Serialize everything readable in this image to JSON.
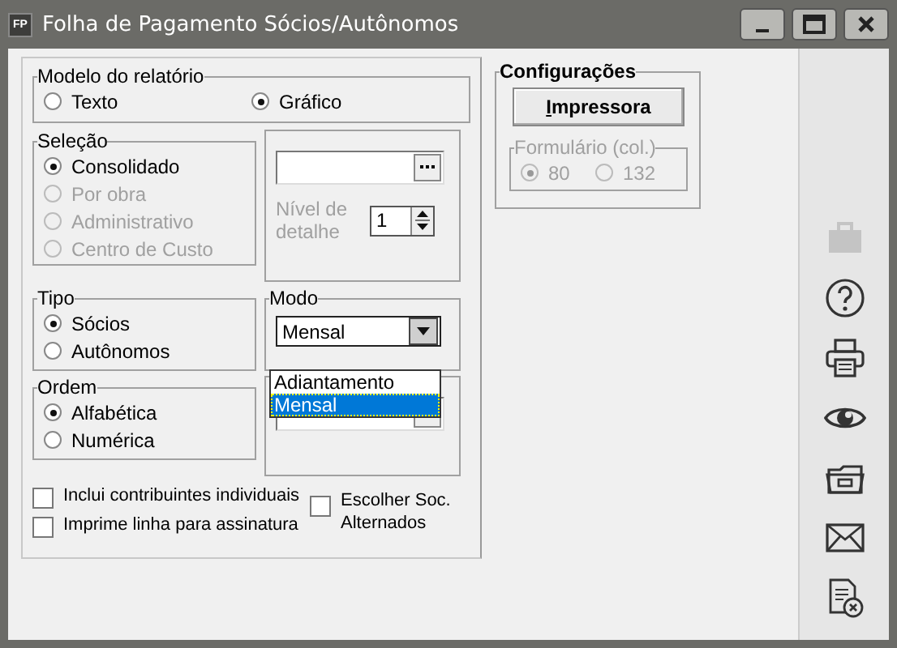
{
  "window": {
    "title": "Folha de Pagamento Sócios/Autônomos",
    "icon": "FP"
  },
  "report_model": {
    "label": "Modelo do relatório",
    "options": [
      {
        "label": "Texto",
        "selected": false,
        "disabled": false
      },
      {
        "label": "Gráfico",
        "selected": true,
        "disabled": false
      }
    ]
  },
  "selection": {
    "label": "Seleção",
    "options": [
      {
        "label": "Consolidado",
        "selected": true,
        "disabled": false
      },
      {
        "label": "Por obra",
        "selected": false,
        "disabled": true
      },
      {
        "label": "Administrativo",
        "selected": false,
        "disabled": true
      },
      {
        "label": "Centro de Custo",
        "selected": false,
        "disabled": true
      }
    ]
  },
  "detail": {
    "label": "Nível de detalhe",
    "value": "1",
    "disabled": true
  },
  "type": {
    "label": "Tipo",
    "options": [
      {
        "label": "Sócios",
        "selected": true,
        "disabled": false
      },
      {
        "label": "Autônomos",
        "selected": false,
        "disabled": false
      }
    ]
  },
  "mode": {
    "label": "Modo",
    "value": "Mensal",
    "expanded": true,
    "options": [
      {
        "label": "Adiantamento",
        "selected": false
      },
      {
        "label": "Mensal",
        "selected": true
      }
    ]
  },
  "order": {
    "label": "Ordem",
    "options": [
      {
        "label": "Alfabética",
        "selected": true,
        "disabled": false
      },
      {
        "label": "Numérica",
        "selected": false,
        "disabled": false
      }
    ]
  },
  "checkboxes": [
    {
      "label": "Inclui contribuintes individuais",
      "checked": false
    },
    {
      "label": "Imprime linha para assinatura",
      "checked": false
    }
  ],
  "alternate": {
    "label": "Escolher Soc. Alternados",
    "checked": false
  },
  "config": {
    "label": "Configurações",
    "button": "Impressora",
    "form": {
      "label": "Formulário (col.)",
      "options": [
        {
          "label": "80",
          "selected": true,
          "disabled": true
        },
        {
          "label": "132",
          "selected": false,
          "disabled": true
        }
      ]
    }
  },
  "toolbar": [
    {
      "kind": "briefcase",
      "disabled": true
    },
    {
      "kind": "help",
      "disabled": false
    },
    {
      "kind": "printer",
      "disabled": false
    },
    {
      "kind": "eye",
      "disabled": false
    },
    {
      "kind": "folder",
      "disabled": false
    },
    {
      "kind": "mail",
      "disabled": false
    },
    {
      "kind": "document",
      "disabled": false
    }
  ]
}
